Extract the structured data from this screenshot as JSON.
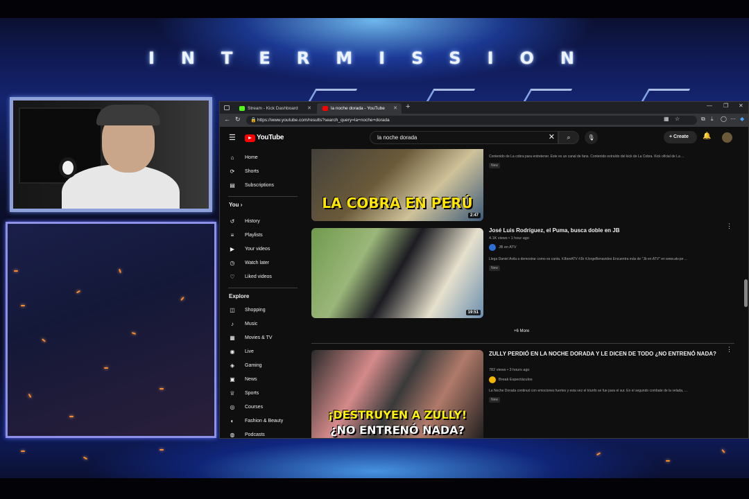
{
  "overlay": {
    "title": "INTERMISSION"
  },
  "browser": {
    "tabs": [
      {
        "label": "Stream - Kick Dashboard",
        "fav_color": "#53fc18"
      },
      {
        "label": "la noche dorada - YouTube",
        "fav_color": "#ff0000"
      }
    ],
    "url": "https://www.youtube.com/results?search_query=la+noche+dorada"
  },
  "youtube": {
    "logo": "YouTube",
    "search_value": "la noche dorada",
    "create_label": "Create",
    "sidebar": {
      "main": [
        {
          "label": "Home",
          "icon": "home-icon",
          "glyph": "⌂"
        },
        {
          "label": "Shorts",
          "icon": "shorts-icon",
          "glyph": "⟳"
        },
        {
          "label": "Subscriptions",
          "icon": "subscriptions-icon",
          "glyph": "▤"
        }
      ],
      "you_label": "You",
      "you": [
        {
          "label": "History",
          "icon": "history-icon",
          "glyph": "↺"
        },
        {
          "label": "Playlists",
          "icon": "playlists-icon",
          "glyph": "≡"
        },
        {
          "label": "Your videos",
          "icon": "your-videos-icon",
          "glyph": "▶"
        },
        {
          "label": "Watch later",
          "icon": "watch-later-icon",
          "glyph": "◷"
        },
        {
          "label": "Liked videos",
          "icon": "liked-videos-icon",
          "glyph": "👍"
        }
      ],
      "explore_label": "Explore",
      "explore": [
        {
          "label": "Shopping",
          "icon": "shopping-icon",
          "glyph": "◫"
        },
        {
          "label": "Music",
          "icon": "music-icon",
          "glyph": "♪"
        },
        {
          "label": "Movies & TV",
          "icon": "movies-icon",
          "glyph": "▦"
        },
        {
          "label": "Live",
          "icon": "live-icon",
          "glyph": "◉"
        },
        {
          "label": "Gaming",
          "icon": "gaming-icon",
          "glyph": "◈"
        },
        {
          "label": "News",
          "icon": "news-icon",
          "glyph": "▣"
        },
        {
          "label": "Sports",
          "icon": "sports-icon",
          "glyph": "♕"
        },
        {
          "label": "Courses",
          "icon": "courses-icon",
          "glyph": "◎"
        },
        {
          "label": "Fashion & Beauty",
          "icon": "fashion-icon",
          "glyph": "◐"
        },
        {
          "label": "Podcasts",
          "icon": "podcasts-icon",
          "glyph": "◍"
        }
      ]
    },
    "results": [
      {
        "thumb_caption": "LA COBRA EN PERÚ",
        "duration": "2:47",
        "description": "Contenido de La cobra para entretener. Este es un canal de fans. Contenido extraído del kick de La Cobra. Kick oficial de La ...",
        "badge": "New"
      },
      {
        "title": "José Luis Rodríguez, el Puma, busca doble en JB",
        "meta": "4.1K views • 1 hour ago",
        "channel": "JB en ATV",
        "description": "Llega Daniel Ávila a demostrar como es canta. #JbenATV #Jb #JorgeBenavides Encuentra más de \"Jb en ATV\" en www.atv.pe ...",
        "badge": "New",
        "duration": "19:51",
        "more": "+6 More"
      },
      {
        "title": "ZULLY PERDIÓ EN LA NOCHE DORADA Y LE DICEN DE TODO ¿NO ENTRENÓ NADA?",
        "meta": "782 views • 3 hours ago",
        "channel": "Break Espectáculos",
        "description": "La Noche Dorada continuó con emociones fuertes y esta vez el triunfo se fue para el sur. En el segundo combate de la velada, ...",
        "badge": "New",
        "thumb_caption_1": "¡DESTRUYEN A ZULLY!",
        "thumb_caption_2": "¿NO ENTRENÓ NADA?"
      }
    ]
  }
}
